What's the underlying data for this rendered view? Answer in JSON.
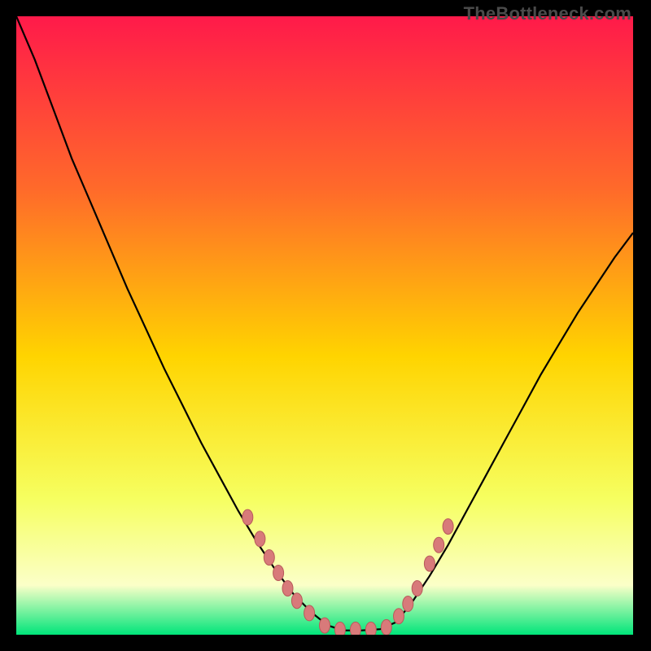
{
  "watermark": "TheBottleneck.com",
  "colors": {
    "frame": "#000000",
    "gradient_top": "#ff1a4a",
    "gradient_upper_mid": "#ff6a2a",
    "gradient_mid": "#ffd400",
    "gradient_lower_mid": "#f6ff60",
    "gradient_pale": "#fbffc8",
    "gradient_bottom": "#00e57a",
    "curve": "#000000",
    "marker_fill": "#d87a7a",
    "marker_stroke": "#b85a5a"
  },
  "chart_data": {
    "type": "line",
    "title": "",
    "xlabel": "",
    "ylabel": "",
    "xlim": [
      0,
      100
    ],
    "ylim": [
      0,
      100
    ],
    "grid": false,
    "curve": {
      "name": "bottleneck-v-curve",
      "comment": "Two-branch V curve; y = estimated bottleneck-like metric (100 top, 0 bottom)",
      "points": [
        {
          "x": 0.0,
          "y": 100.0
        },
        {
          "x": 3.0,
          "y": 93.0
        },
        {
          "x": 6.0,
          "y": 85.0
        },
        {
          "x": 9.0,
          "y": 77.0
        },
        {
          "x": 12.0,
          "y": 70.0
        },
        {
          "x": 15.0,
          "y": 63.0
        },
        {
          "x": 18.0,
          "y": 56.0
        },
        {
          "x": 21.0,
          "y": 49.5
        },
        {
          "x": 24.0,
          "y": 43.0
        },
        {
          "x": 27.0,
          "y": 37.0
        },
        {
          "x": 30.0,
          "y": 31.0
        },
        {
          "x": 33.0,
          "y": 25.5
        },
        {
          "x": 36.0,
          "y": 20.0
        },
        {
          "x": 39.0,
          "y": 15.0
        },
        {
          "x": 42.0,
          "y": 10.5
        },
        {
          "x": 45.0,
          "y": 6.5
        },
        {
          "x": 48.0,
          "y": 3.5
        },
        {
          "x": 50.5,
          "y": 1.5
        },
        {
          "x": 53.0,
          "y": 0.7
        },
        {
          "x": 56.0,
          "y": 0.7
        },
        {
          "x": 59.0,
          "y": 0.9
        },
        {
          "x": 61.5,
          "y": 2.0
        },
        {
          "x": 64.0,
          "y": 5.0
        },
        {
          "x": 67.0,
          "y": 9.5
        },
        {
          "x": 70.0,
          "y": 14.5
        },
        {
          "x": 73.0,
          "y": 20.0
        },
        {
          "x": 76.0,
          "y": 25.5
        },
        {
          "x": 79.0,
          "y": 31.0
        },
        {
          "x": 82.0,
          "y": 36.5
        },
        {
          "x": 85.0,
          "y": 42.0
        },
        {
          "x": 88.0,
          "y": 47.0
        },
        {
          "x": 91.0,
          "y": 52.0
        },
        {
          "x": 94.0,
          "y": 56.5
        },
        {
          "x": 97.0,
          "y": 61.0
        },
        {
          "x": 100.0,
          "y": 65.0
        }
      ]
    },
    "markers": {
      "comment": "Salmon oval markers clustered near the trough of the V, both branches",
      "points": [
        {
          "x": 37.5,
          "y": 19.0
        },
        {
          "x": 39.5,
          "y": 15.5
        },
        {
          "x": 41.0,
          "y": 12.5
        },
        {
          "x": 42.5,
          "y": 10.0
        },
        {
          "x": 44.0,
          "y": 7.5
        },
        {
          "x": 45.5,
          "y": 5.5
        },
        {
          "x": 47.5,
          "y": 3.5
        },
        {
          "x": 50.0,
          "y": 1.5
        },
        {
          "x": 52.5,
          "y": 0.8
        },
        {
          "x": 55.0,
          "y": 0.8
        },
        {
          "x": 57.5,
          "y": 0.8
        },
        {
          "x": 60.0,
          "y": 1.2
        },
        {
          "x": 62.0,
          "y": 3.0
        },
        {
          "x": 63.5,
          "y": 5.0
        },
        {
          "x": 65.0,
          "y": 7.5
        },
        {
          "x": 67.0,
          "y": 11.5
        },
        {
          "x": 68.5,
          "y": 14.5
        },
        {
          "x": 70.0,
          "y": 17.5
        }
      ]
    }
  }
}
